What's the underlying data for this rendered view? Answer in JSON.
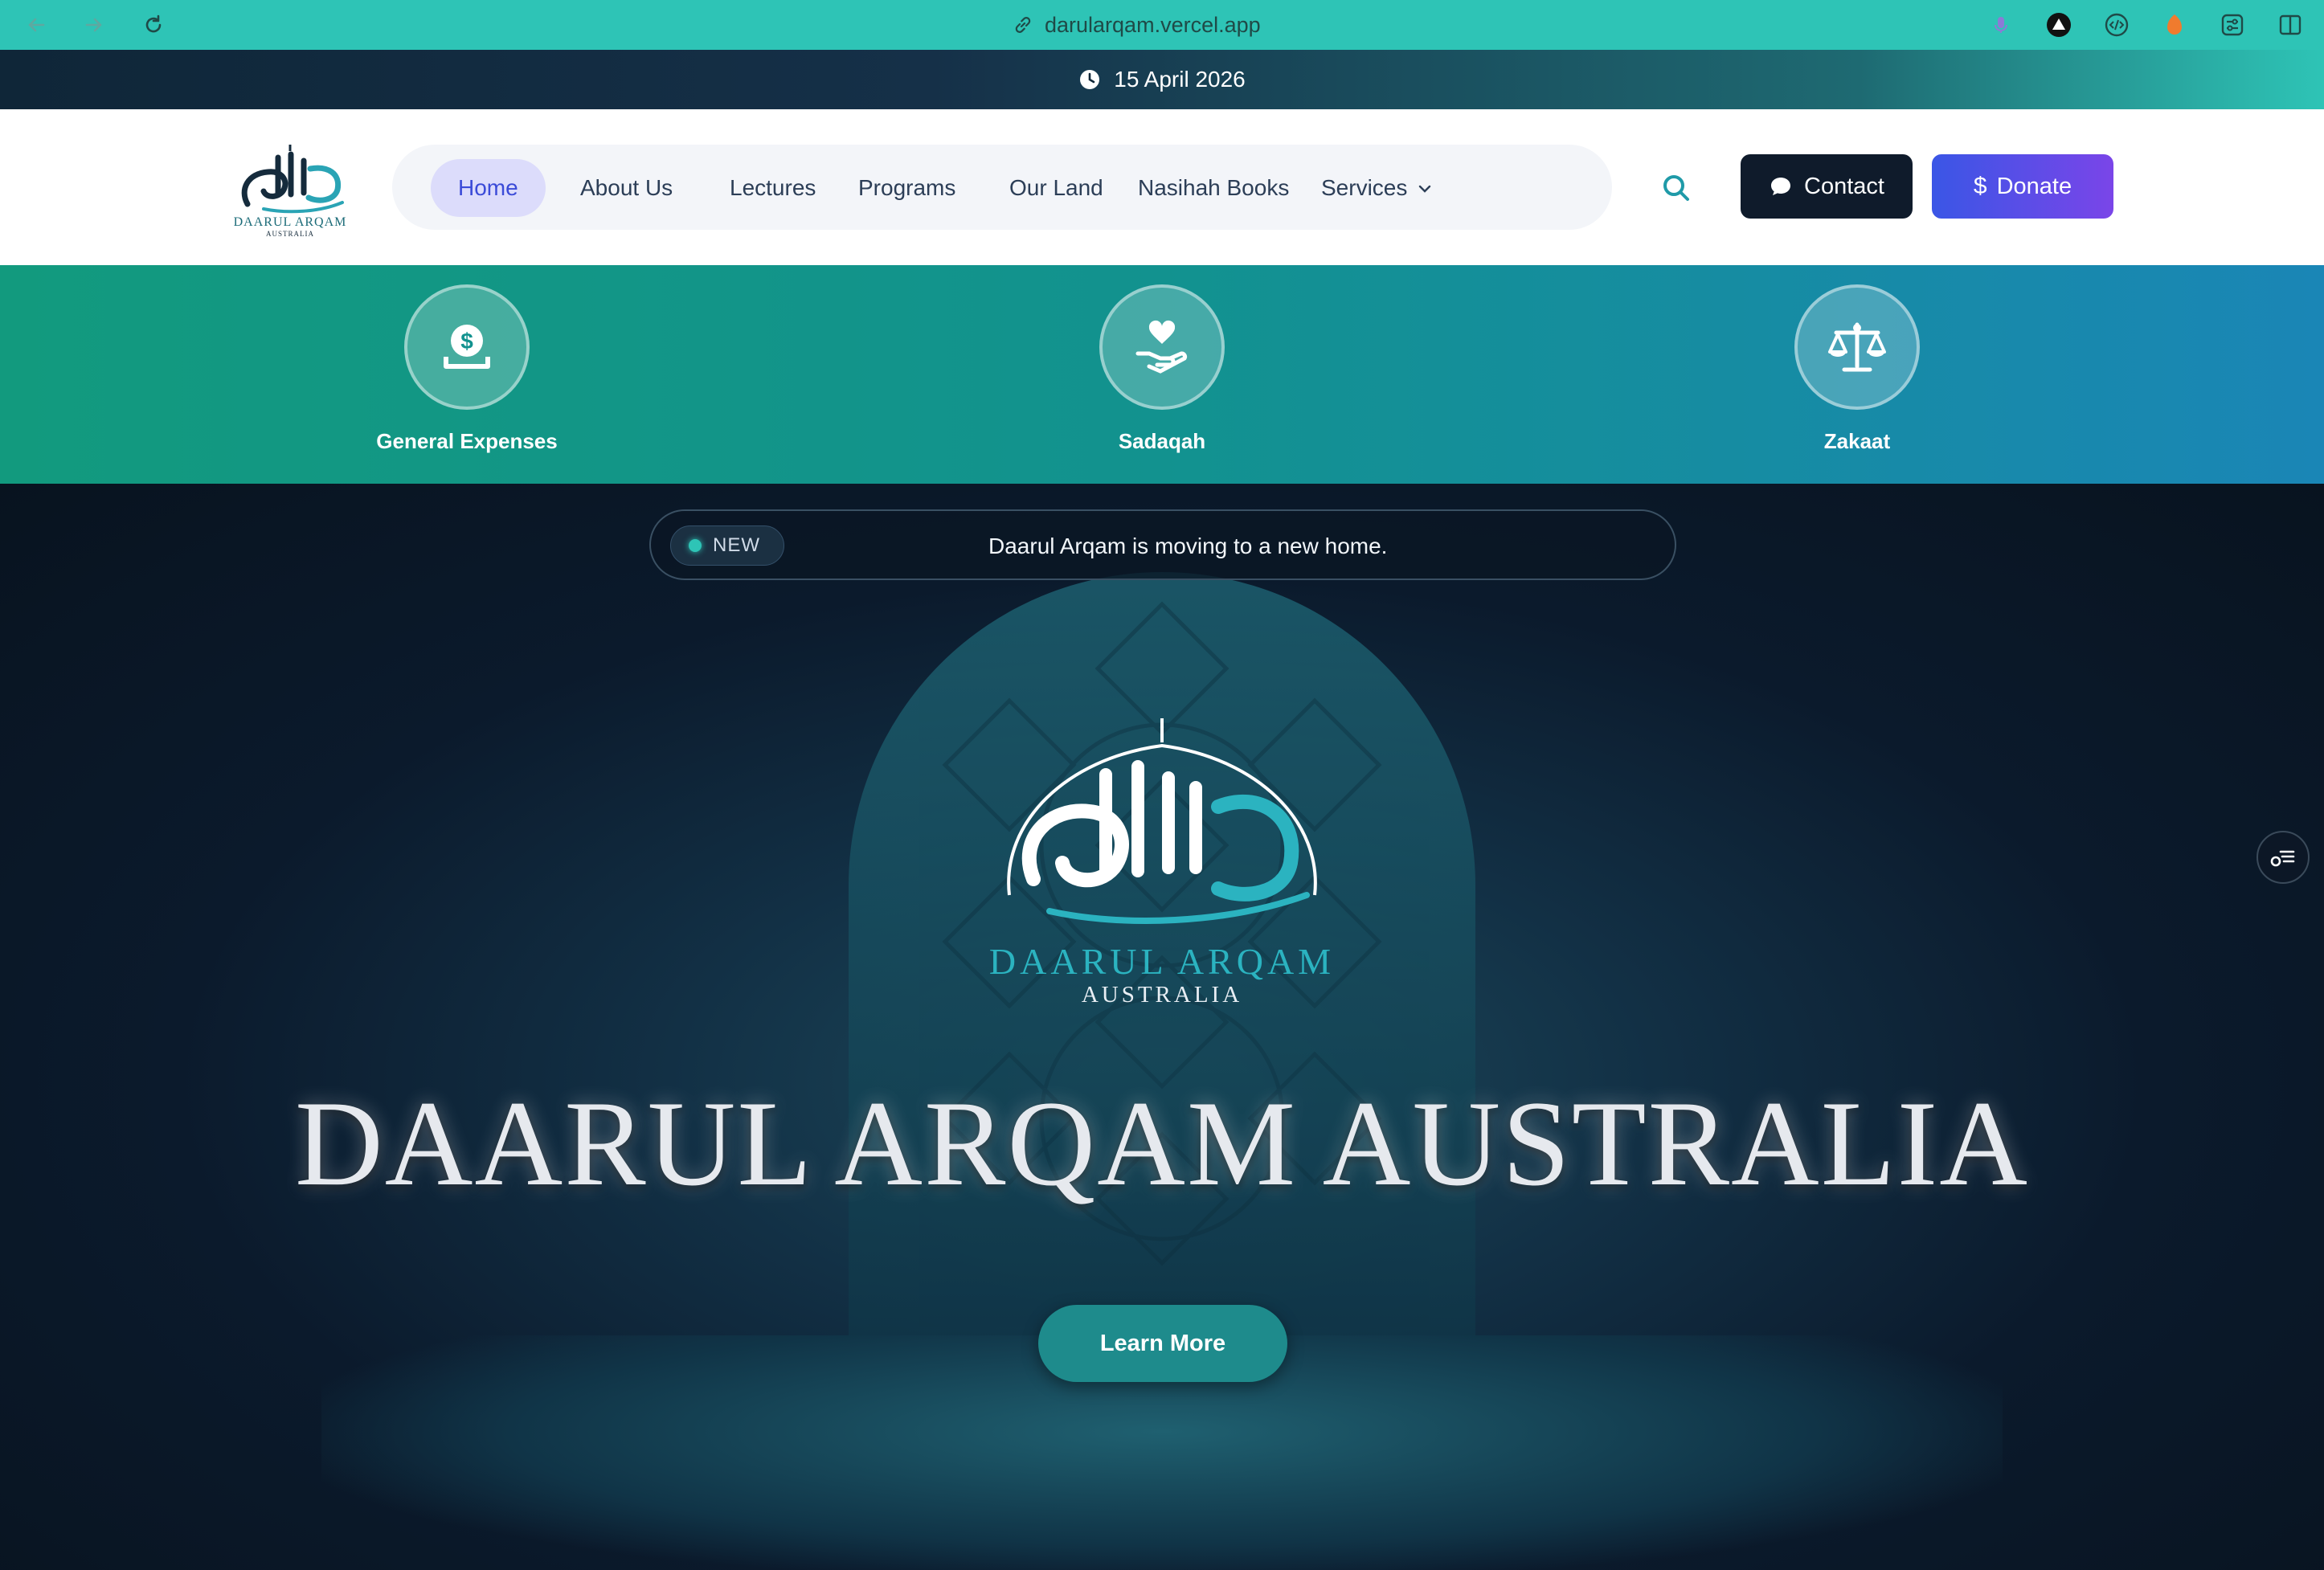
{
  "browser": {
    "url": "darularqam.vercel.app"
  },
  "datebar": {
    "date": "15 April 2026"
  },
  "header": {
    "logo_text": "DAARUL ARQAM",
    "logo_sub": "AUSTRALIA",
    "nav": [
      {
        "label": "Home",
        "active": true
      },
      {
        "label": "About Us"
      },
      {
        "label": "Lectures"
      },
      {
        "label": "Programs"
      },
      {
        "label": "Our Land"
      },
      {
        "label": "Nasihah Books"
      },
      {
        "label": "Services"
      }
    ],
    "contact_label": "Contact",
    "donate_label": "Donate"
  },
  "donations": [
    {
      "label": "General Expenses",
      "icon": "money-bag-icon"
    },
    {
      "label": "Sadaqah",
      "icon": "hand-heart-icon"
    },
    {
      "label": "Zakaat",
      "icon": "scale-icon"
    }
  ],
  "hero": {
    "badge": "NEW",
    "announcement": "Daarul Arqam is moving to a new home.",
    "emblem_title": "DAARUL ARQAM",
    "emblem_sub": "AUSTRALIA",
    "title": "DAARUL ARQAM AUSTRALIA",
    "cta": "Learn More"
  },
  "colors": {
    "accent": "#2ec4b6",
    "primary": "#3b4bd8",
    "dark": "#0f1b2b"
  }
}
